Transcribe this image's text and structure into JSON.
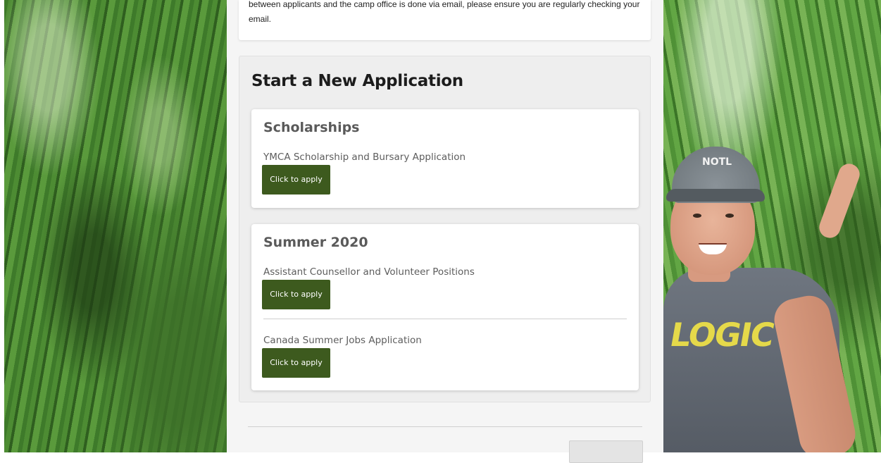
{
  "intro": {
    "text": "between applicants and the camp office is done via email, please ensure you are regularly checking your email."
  },
  "panel": {
    "title": "Start a New Application"
  },
  "categories": [
    {
      "title": "Scholarships",
      "entries": [
        {
          "label": "YMCA Scholarship and Bursary Application",
          "button": "Click to apply"
        }
      ]
    },
    {
      "title": "Summer 2020",
      "entries": [
        {
          "label": "Assistant Counsellor and Volunteer Positions",
          "button": "Click to apply"
        },
        {
          "label": "Canada Summer Jobs Application",
          "button": "Click to apply"
        }
      ]
    }
  ],
  "background": {
    "cap_text": "NOTL",
    "shirt_text": "LOGIC"
  },
  "colors": {
    "apply_button": "#3d5a1e",
    "panel_bg": "#eeeeee",
    "card_bg": "#ffffff"
  }
}
